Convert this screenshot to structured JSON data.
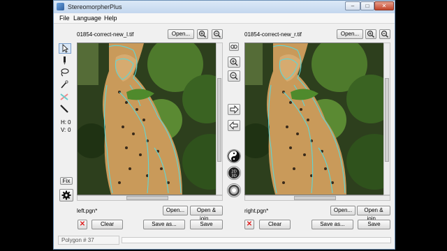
{
  "window": {
    "title": "StereomorpherPlus",
    "minimize": "–",
    "maximize": "□",
    "close": "✕"
  },
  "menu": [
    "File",
    "Language",
    "Help"
  ],
  "left": {
    "filename": "01854-correct-new_l.tif",
    "open_label": "Open...",
    "file_label": "left.pgn*",
    "open2_label": "Open...",
    "open_join_label": "Open & join...",
    "clear_label": "Clear",
    "save_as_label": "Save as...",
    "save_label": "Save"
  },
  "right": {
    "filename": "01854-correct-new_r.tif",
    "open_label": "Open...",
    "file_label": "right.pgn*",
    "open2_label": "Open...",
    "open_join_label": "Open & join...",
    "clear_label": "Clear",
    "save_as_label": "Save as...",
    "save_label": "Save"
  },
  "tools": {
    "h_label": "H:",
    "h_value": "0",
    "v_label": "V:",
    "v_value": "0",
    "fix_label": "Fix"
  },
  "status": {
    "polygon": "Polygon # 37"
  },
  "colors": {
    "outline": "#5fd6d6",
    "titlebar": "#c3d7ee",
    "close": "#c3452b"
  },
  "icons": [
    "pointer-icon",
    "pen-icon",
    "lasso-icon",
    "magic-wand-icon",
    "cross-brush-icon",
    "ruler-icon",
    "settings-icon",
    "zoom-in-icon",
    "zoom-out-icon",
    "arrow-right-icon",
    "arrow-left-icon",
    "yin-yang-icon",
    "2d-3d-icon",
    "target-icon"
  ]
}
